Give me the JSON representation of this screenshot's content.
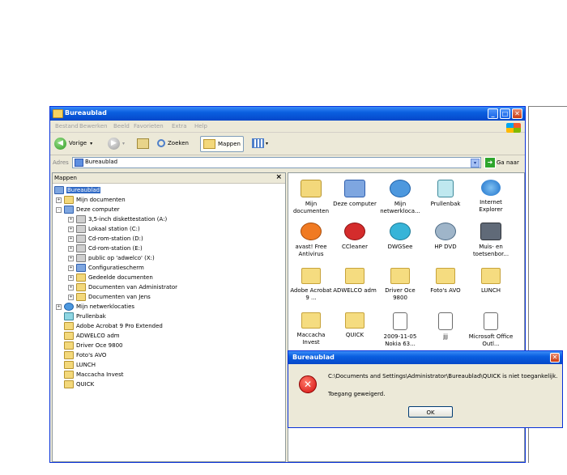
{
  "window": {
    "title": "Bureaublad",
    "min_label": "_",
    "max_label": "□",
    "close_label": "✕"
  },
  "menu": [
    "Bestand",
    "Bewerken",
    "Beeld",
    "Favorieten",
    "Extra",
    "Help"
  ],
  "toolbar": {
    "back_label": "Vorige",
    "back_drop": "▾",
    "search_label": "Zoeken",
    "folders_label": "Mappen",
    "view_drop": "▾"
  },
  "address": {
    "label": "Adres",
    "value": "Bureaublad",
    "go_label": "Ga naar",
    "drop": "▾"
  },
  "left_pane": {
    "header": "Mappen",
    "close": "×",
    "tree": [
      {
        "label": "Bureaublad",
        "expander": "",
        "icon": "desktop"
      },
      {
        "label": "Mijn documenten",
        "expander": "+",
        "icon": "folder"
      },
      {
        "label": "Deze computer",
        "expander": "-",
        "icon": "computer"
      },
      {
        "label": "3,5-inch diskettestation (A:)",
        "expander": "+",
        "icon": "drive"
      },
      {
        "label": "Lokaal station (C:)",
        "expander": "+",
        "icon": "drive"
      },
      {
        "label": "Cd-rom-station (D:)",
        "expander": "+",
        "icon": "drive"
      },
      {
        "label": "Cd-rom-station (E:)",
        "expander": "+",
        "icon": "drive"
      },
      {
        "label": "public op 'adwelco' (X:)",
        "expander": "+",
        "icon": "drive"
      },
      {
        "label": "Configuratiescherm",
        "expander": "+",
        "icon": "folder"
      },
      {
        "label": "Gedeelde documenten",
        "expander": "+",
        "icon": "folder"
      },
      {
        "label": "Documenten van Administrator",
        "expander": "+",
        "icon": "folder"
      },
      {
        "label": "Documenten van Jens",
        "expander": "+",
        "icon": "folder"
      },
      {
        "label": "Mijn netwerklocaties",
        "expander": "+",
        "icon": "network"
      },
      {
        "label": "Prullenbak",
        "expander": "",
        "icon": "bin"
      },
      {
        "label": "Adobe Acrobat 9 Pro Extended",
        "expander": "",
        "icon": "folder"
      },
      {
        "label": "ADWELCO adm",
        "expander": "",
        "icon": "folder"
      },
      {
        "label": "Driver Oce 9800",
        "expander": "",
        "icon": "folder"
      },
      {
        "label": "Foto's AVO",
        "expander": "",
        "icon": "folder"
      },
      {
        "label": "LUNCH",
        "expander": "",
        "icon": "folder"
      },
      {
        "label": "Maccacha Invest",
        "expander": "",
        "icon": "folder"
      },
      {
        "label": "QUICK",
        "expander": "",
        "icon": "folder"
      }
    ]
  },
  "icons": [
    {
      "label": "Mijn documenten",
      "icon": "my-documents"
    },
    {
      "label": "Deze computer",
      "icon": "my-computer"
    },
    {
      "label": "Mijn netwerkloca...",
      "icon": "network-places"
    },
    {
      "label": "Prullenbak",
      "icon": "recycle-bin"
    },
    {
      "label": "Internet Explorer",
      "icon": "internet-explorer"
    },
    {
      "label": "avast! Free Antivirus",
      "icon": "avast"
    },
    {
      "label": "CCleaner",
      "icon": "ccleaner"
    },
    {
      "label": "DWGSee",
      "icon": "dwgsee"
    },
    {
      "label": "HP DVD",
      "icon": "hp-dvd"
    },
    {
      "label": "Muis- en toetsenbor...",
      "icon": "mouse-keyboard"
    },
    {
      "label": "Adobe Acrobat 9 ...",
      "icon": "folder"
    },
    {
      "label": "ADWELCO adm",
      "icon": "folder"
    },
    {
      "label": "Driver Oce 9800",
      "icon": "folder"
    },
    {
      "label": "Foto's AVO",
      "icon": "folder"
    },
    {
      "label": "LUNCH",
      "icon": "folder"
    },
    {
      "label": "Maccacha Invest",
      "icon": "folder"
    },
    {
      "label": "QUICK",
      "icon": "folder"
    },
    {
      "label": "2009-11-05 Nokia 63...",
      "icon": "document-shortcut"
    },
    {
      "label": "jjj",
      "icon": "text-document"
    },
    {
      "label": "Microsoft Office Outl...",
      "icon": "document-shortcut"
    }
  ],
  "dialog": {
    "title": "Bureaublad",
    "close": "✕",
    "message": "C:\\Documents and Settings\\Administrator\\Bureaublad\\QUICK is niet toegankelijk.",
    "detail": "Toegang geweigerd.",
    "ok_label": "OK"
  }
}
